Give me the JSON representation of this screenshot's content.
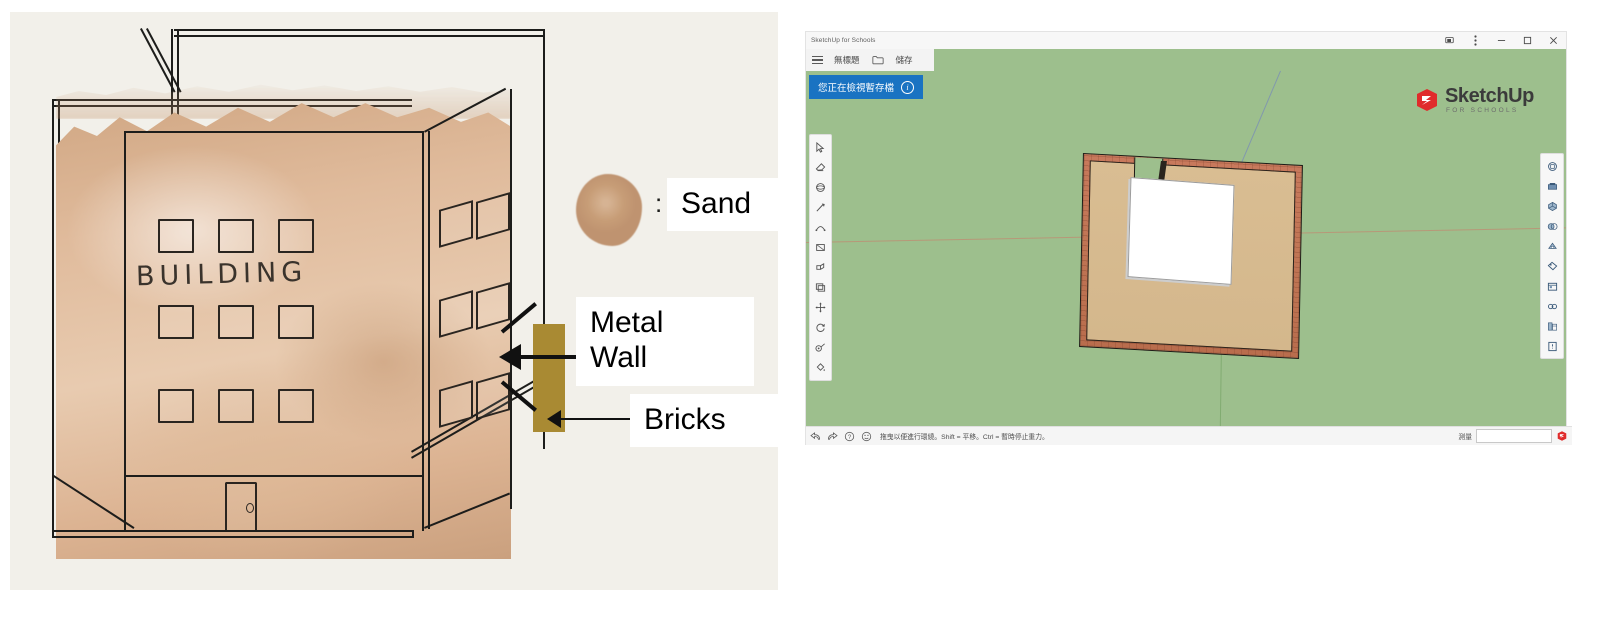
{
  "illustration": {
    "building_text": "BUILDING",
    "legend": {
      "sand_label": "Sand",
      "sand_colon": ":",
      "metal_label": "Metal\nWall",
      "bricks_label": "Bricks"
    },
    "colors": {
      "panel_bg": "#f2f0ea",
      "sand_fill": "#dcb392",
      "metal_wall": "#a98a33",
      "ink": "#1d1d1b"
    }
  },
  "sketchup": {
    "titlebar": {
      "title": "SketchUp for Schools",
      "controls": {
        "cast": "❐",
        "kebab": "⋮",
        "minimize": "─",
        "maximize": "❐",
        "close": "✕"
      }
    },
    "menubar": {
      "hamburger": "menu",
      "document_name": "無標題",
      "folder": "folder",
      "save_label": "儲存"
    },
    "banner": {
      "message": "您正在檢視暫存檔",
      "info": "i"
    },
    "brand": {
      "name": "SketchUp",
      "subtitle": "FOR SCHOOLS"
    },
    "left_tools": [
      {
        "name": "select-tool"
      },
      {
        "name": "eraser-tool"
      },
      {
        "name": "orbit-tool"
      },
      {
        "name": "line-tool"
      },
      {
        "name": "arc-tool"
      },
      {
        "name": "rectangle-tool"
      },
      {
        "name": "pushpull-tool"
      },
      {
        "name": "offset-tool"
      },
      {
        "name": "move-tool"
      },
      {
        "name": "rotate-tool"
      },
      {
        "name": "tape-measure-tool"
      },
      {
        "name": "paint-bucket-tool"
      }
    ],
    "right_tray": [
      {
        "name": "entity-info-panel"
      },
      {
        "name": "materials-panel"
      },
      {
        "name": "components-panel"
      },
      {
        "name": "styles-panel"
      },
      {
        "name": "layers-panel"
      },
      {
        "name": "tags-panel"
      },
      {
        "name": "scenes-panel"
      },
      {
        "name": "shadows-panel"
      },
      {
        "name": "instructor-panel"
      },
      {
        "name": "model-info-panel"
      }
    ],
    "statusbar": {
      "hint": "拖曳以便進行環繞。Shift = 平移。Ctrl = 暫時停止重力。",
      "undo": "↶",
      "redo": "↷",
      "help": "?",
      "instructor": "☺",
      "measure_label": "測量",
      "measure_value": ""
    },
    "viewport": {
      "background_color": "#9dbf8d",
      "axis_red": "#c08b72",
      "axis_green": "#7da86c",
      "axis_blue": "#7a8fb5",
      "model": {
        "brick_ring": "#c07554",
        "sand_plate": "#d4b78c",
        "building": "#ffffff"
      }
    }
  }
}
